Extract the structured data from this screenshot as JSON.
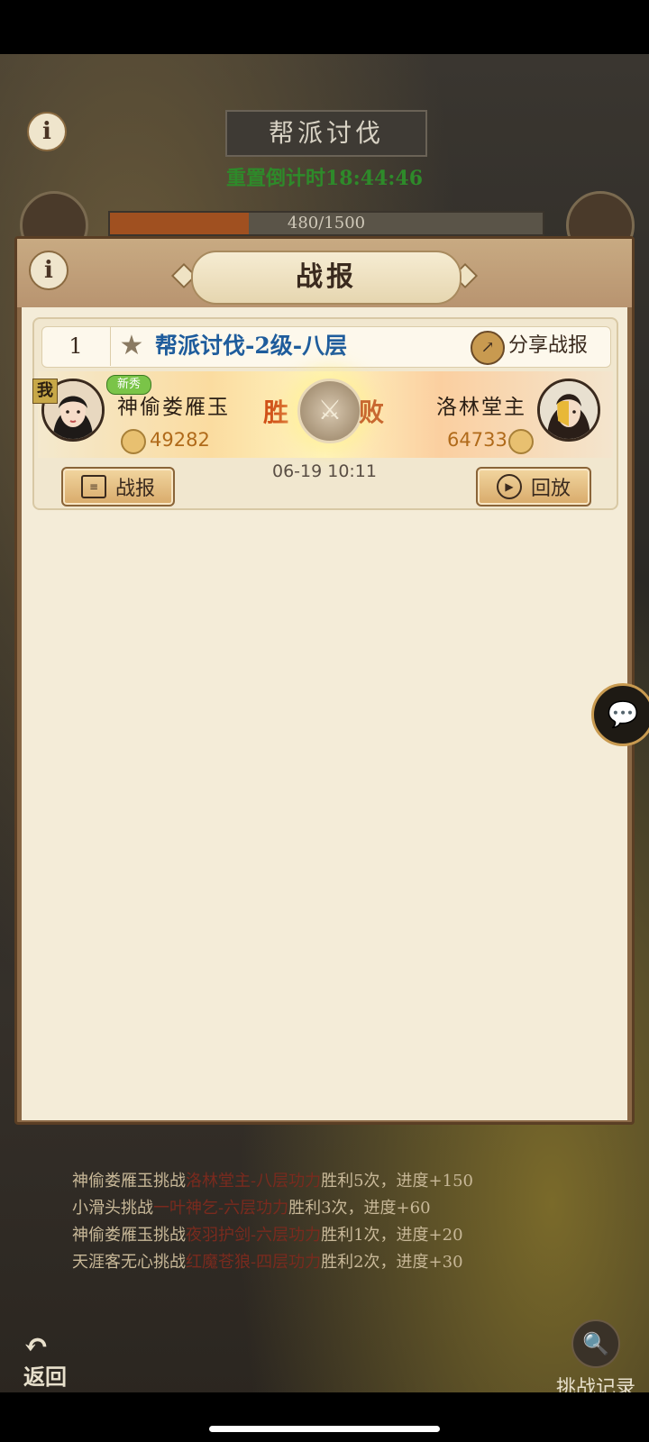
{
  "background": {
    "title": "帮派讨伐",
    "countdown": "重置倒计时18:44:46",
    "progress_text": "480/1500",
    "progress_value": 0.32,
    "log": [
      {
        "a": "神偷娄雁玉挑战",
        "b": "洛林堂主-八层功力",
        "c": "胜利5次，进度+150"
      },
      {
        "a": "小滑头挑战",
        "b": "一叶神乞-六层功力",
        "c": "胜利3次，进度+60"
      },
      {
        "a": "神偷娄雁玉挑战",
        "b": "夜羽护剑-六层功力",
        "c": "胜利1次，进度+20"
      },
      {
        "a": "天涯客无心挑战",
        "b": "红魔苍狼-四层功力",
        "c": "胜利2次，进度+30"
      }
    ],
    "back_label": "返回",
    "record_label": "挑战记录"
  },
  "dialog": {
    "title": "战报",
    "info_icon": "i"
  },
  "report": {
    "rank": "1",
    "battle_name": "帮派讨伐-2级-八层",
    "share_label": "分享战报",
    "me_badge": "我",
    "rookie_badge": "新秀",
    "my_name": "神偷娄雁玉",
    "my_power": "49282",
    "result_win": "胜",
    "result_lose": "败",
    "enemy_name": "洛林堂主",
    "enemy_power": "64733",
    "time": "06-19 10:11",
    "report_button": "战报",
    "replay_button": "回放"
  },
  "colors": {
    "battle_name": "#1e5c9c",
    "power": "#b06a1a",
    "win": "#d05018",
    "countdown": "#2e8a2a"
  }
}
